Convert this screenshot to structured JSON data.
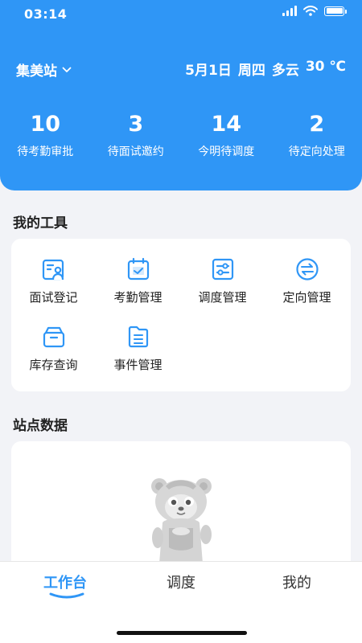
{
  "status_bar": {
    "time": "03:14"
  },
  "header": {
    "station": "集美站",
    "weather": {
      "date": "5月1日",
      "weekday": "周四",
      "condition": "多云",
      "temperature": "30 ℃"
    },
    "stats": [
      {
        "value": "10",
        "label": "待考勤审批"
      },
      {
        "value": "3",
        "label": "待面试邀约"
      },
      {
        "value": "14",
        "label": "今明待调度"
      },
      {
        "value": "2",
        "label": "待定向处理"
      }
    ]
  },
  "tools": {
    "title": "我的工具",
    "items": [
      {
        "label": "面试登记",
        "icon": "interview-register-icon"
      },
      {
        "label": "考勤管理",
        "icon": "attendance-calendar-icon"
      },
      {
        "label": "调度管理",
        "icon": "dispatch-sliders-icon"
      },
      {
        "label": "定向管理",
        "icon": "directional-arrows-icon"
      },
      {
        "label": "库存查询",
        "icon": "inventory-box-icon"
      },
      {
        "label": "事件管理",
        "icon": "event-list-icon"
      }
    ]
  },
  "site_data": {
    "title": "站点数据"
  },
  "tabbar": {
    "tabs": [
      {
        "label": "工作台",
        "active": true
      },
      {
        "label": "调度",
        "active": false
      },
      {
        "label": "我的",
        "active": false
      }
    ]
  },
  "colors": {
    "primary": "#2f96f6",
    "background": "#f2f3f7"
  }
}
